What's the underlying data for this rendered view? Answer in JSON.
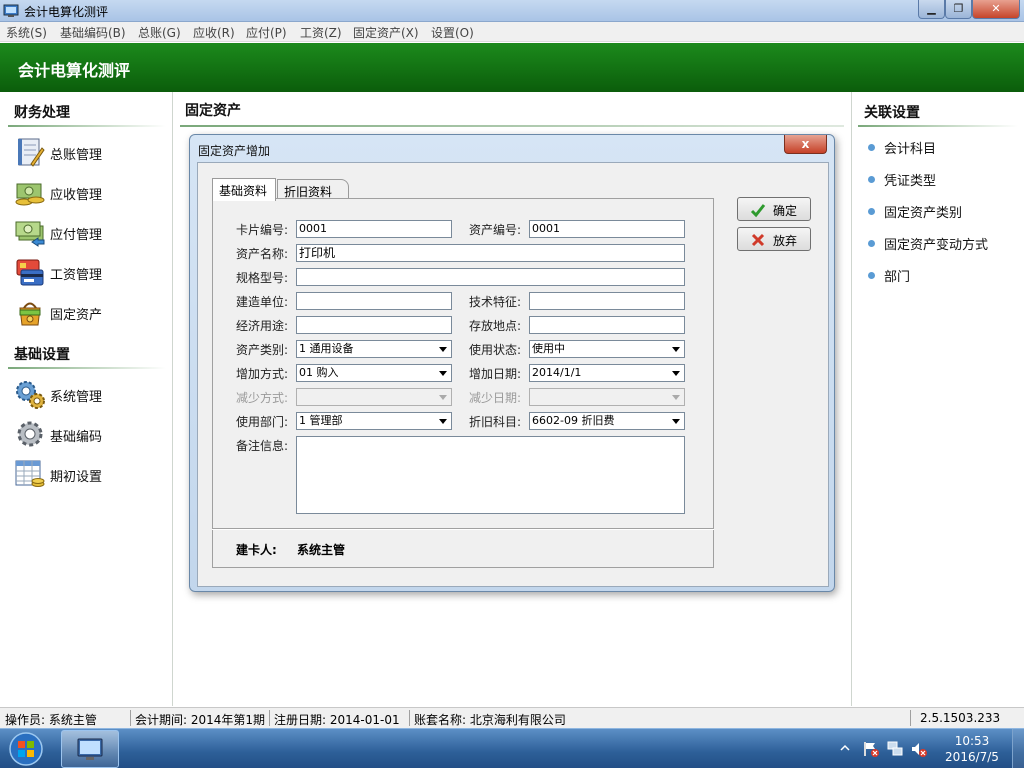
{
  "window": {
    "title": "会计电算化测评"
  },
  "menu": [
    "系统(S)",
    "基础编码(B)",
    "总账(G)",
    "应收(R)",
    "应付(P)",
    "工资(Z)",
    "固定资产(X)",
    "设置(O)"
  ],
  "header": {
    "title": "会计电算化测评"
  },
  "left": {
    "section1": "财务处理",
    "items1": [
      {
        "label": "总账管理",
        "icon": "ledger-icon"
      },
      {
        "label": "应收管理",
        "icon": "receivable-icon"
      },
      {
        "label": "应付管理",
        "icon": "payable-icon"
      },
      {
        "label": "工资管理",
        "icon": "payroll-icon"
      },
      {
        "label": "固定资产",
        "icon": "fixed-asset-icon"
      }
    ],
    "section2": "基础设置",
    "items2": [
      {
        "label": "系统管理",
        "icon": "gears-icon"
      },
      {
        "label": "基础编码",
        "icon": "gear-icon"
      },
      {
        "label": "期初设置",
        "icon": "spreadsheet-icon"
      }
    ]
  },
  "center": {
    "title": "固定资产"
  },
  "right": {
    "section": "关联设置",
    "items": [
      "会计科目",
      "凭证类型",
      "固定资产类别",
      "固定资产变动方式",
      "部门"
    ]
  },
  "dialog": {
    "title": "固定资产增加",
    "close": "x",
    "tabs": [
      "基础资料",
      "折旧资料"
    ],
    "ok": "确定",
    "cancel": "放弃",
    "fields": {
      "card_no_label": "卡片编号:",
      "card_no": "0001",
      "asset_no_label": "资产编号:",
      "asset_no": "0001",
      "asset_name_label": "资产名称:",
      "asset_name": "打印机",
      "spec_label": "规格型号:",
      "spec": "",
      "builder_label": "建造单位:",
      "builder": "",
      "tech_label": "技术特征:",
      "tech": "",
      "usage_label": "经济用途:",
      "usage": "",
      "location_label": "存放地点:",
      "location": "",
      "category_label": "资产类别:",
      "category": "1 通用设备",
      "status_label": "使用状态:",
      "status": "使用中",
      "add_method_label": "增加方式:",
      "add_method": "01 购入",
      "add_date_label": "增加日期:",
      "add_date": "2014/1/1",
      "reduce_method_label": "减少方式:",
      "reduce_method": "",
      "reduce_date_label": "减少日期:",
      "reduce_date": "",
      "dept_label": "使用部门:",
      "dept": "1 管理部",
      "dep_account_label": "折旧科目:",
      "dep_account": "6602-09 折旧费",
      "remark_label": "备注信息:",
      "remark": ""
    },
    "creator_label": "建卡人:",
    "creator": "系统主管"
  },
  "statusbar": {
    "operator": "操作员: 系统主管",
    "period": "会计期间: 2014年第1期",
    "reg_date": "注册日期: 2014-01-01",
    "company": "账套名称: 北京海利有限公司",
    "version": "2.5.1503.233"
  },
  "taskbar": {
    "time": "10:53",
    "date": "2016/7/5"
  },
  "colors": {
    "header_green": "#0b5d0b",
    "dialog_frame": "#c2d6ec",
    "taskbar_blue": "#2d5f98"
  }
}
